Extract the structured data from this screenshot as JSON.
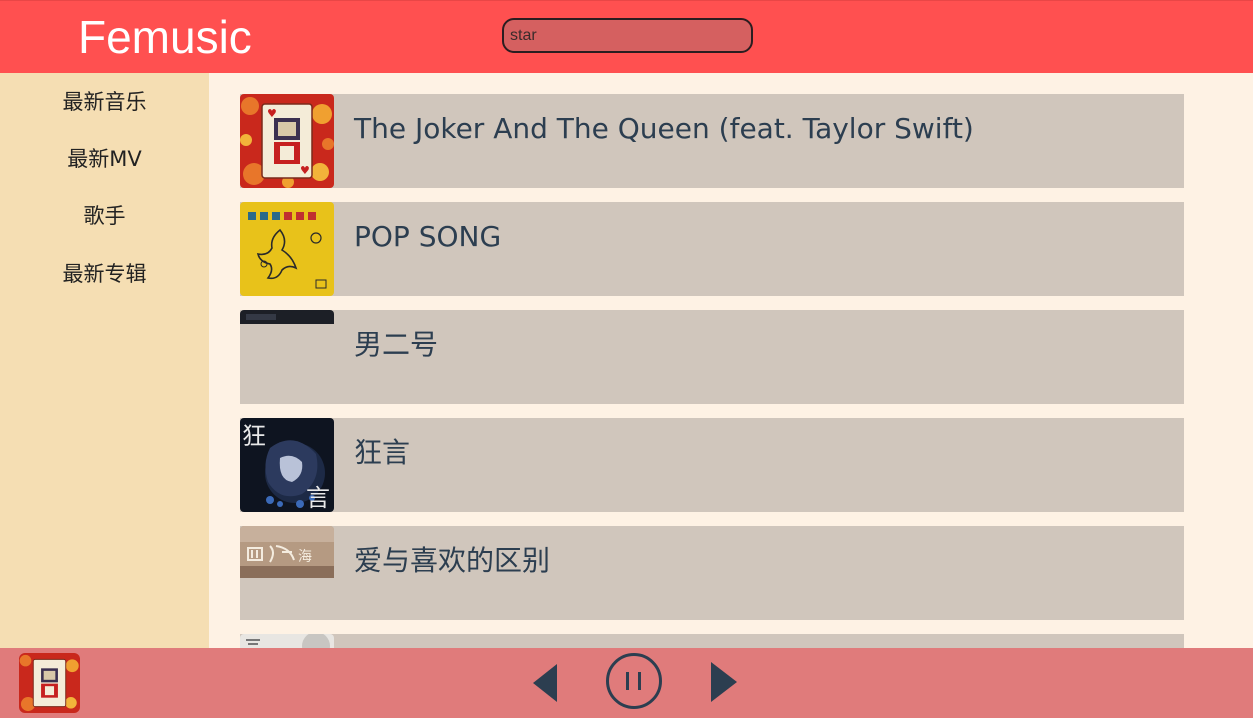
{
  "header": {
    "title": "Femusic",
    "search_value": "star"
  },
  "sidebar": {
    "items": [
      {
        "label": "最新音乐"
      },
      {
        "label": "最新MV"
      },
      {
        "label": "歌手"
      },
      {
        "label": "最新专辑"
      }
    ]
  },
  "songs": [
    {
      "title": "The Joker And The Queen (feat. Taylor Swift)",
      "cover": "joker-queen-card-cover"
    },
    {
      "title": "POP SONG",
      "cover": "pop-song-yellow-cover"
    },
    {
      "title": "男二号",
      "cover": "dark-cover"
    },
    {
      "title": "狂言",
      "cover": "kuangyan-anime-cover"
    },
    {
      "title": "爱与喜欢的区别",
      "cover": "sihai-cover"
    }
  ],
  "player": {
    "current_cover": "joker-queen-card-cover",
    "controls": [
      "previous-icon",
      "pause-icon",
      "next-icon"
    ]
  },
  "colors": {
    "header_bg": "#ff5050",
    "sidebar_bg": "#f5deb3",
    "content_bg": "#fef2e4",
    "row_bg": "#d0c6bc",
    "player_bg": "#e07b7b",
    "control_color": "#2c3e50"
  }
}
